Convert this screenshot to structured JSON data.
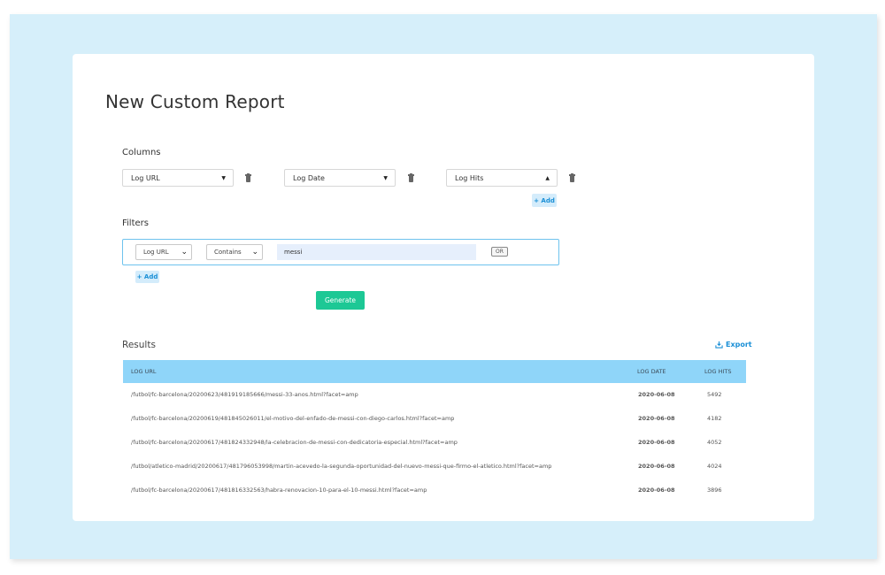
{
  "page": {
    "title": "New Custom Report"
  },
  "columns": {
    "label": "Columns",
    "selects": [
      {
        "value": "Log URL",
        "caret": "▼"
      },
      {
        "value": "Log Date",
        "caret": "▼"
      },
      {
        "value": "Log Hits",
        "caret": "▲"
      }
    ],
    "add_label": "+ Add"
  },
  "filters": {
    "label": "Filters",
    "field": {
      "value": "Log URL",
      "caret": "⌄"
    },
    "operator": {
      "value": "Contains",
      "caret": "⌄"
    },
    "value": "messi",
    "or_label": "OR",
    "add_label": "+ Add"
  },
  "generate_label": "Generate",
  "results": {
    "label": "Results",
    "export_label": "Export",
    "headers": {
      "url": "LOG URL",
      "date": "LOG DATE",
      "hits": "LOG HITS"
    },
    "rows": [
      {
        "url": "/futbol/fc-barcelona/20200623/481919185666/messi-33-anos.html?facet=amp",
        "date": "2020-06-08",
        "hits": "5492"
      },
      {
        "url": "/futbol/fc-barcelona/20200619/481845026011/el-motivo-del-enfado-de-messi-con-diego-carlos.html?facet=amp",
        "date": "2020-06-08",
        "hits": "4182"
      },
      {
        "url": "/futbol/fc-barcelona/20200617/481824332948/la-celebracion-de-messi-con-dedicatoria-especial.html?facet=amp",
        "date": "2020-06-08",
        "hits": "4052"
      },
      {
        "url": "/futbol/atletico-madrid/20200617/481796053998/martin-acevedo-la-segunda-oportunidad-del-nuevo-messi-que-firmo-el-atletico.html?facet=amp",
        "date": "2020-06-08",
        "hits": "4024"
      },
      {
        "url": "/futbol/fc-barcelona/20200617/481816332563/habra-renovacion-10-para-el-10-messi.html?facet=amp",
        "date": "2020-06-08",
        "hits": "3896"
      }
    ]
  },
  "colors": {
    "backdrop": "#d6effa",
    "table_header": "#8fd5f9",
    "generate": "#1dc895",
    "accent": "#1a8fd6"
  }
}
